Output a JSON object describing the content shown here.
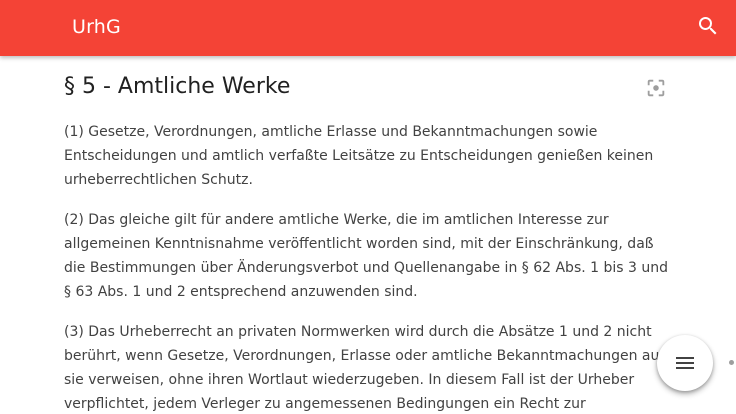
{
  "app_bar": {
    "title": "UrhG",
    "search_icon": "search-icon"
  },
  "section": {
    "title": "§ 5 - Amtliche Werke",
    "focus_icon": "center-focus-icon"
  },
  "paragraphs": [
    "(1) Gesetze, Verordnungen, amtliche Erlasse und Bekanntmachungen sowie\nEntscheidungen und amtlich verfaßte Leitsätze zu Entscheidungen genießen keinen\nurheberrechtlichen Schutz.",
    "(2) Das gleiche gilt für andere amtliche Werke, die im amtlichen Interesse zur\nallgemeinen Kenntnisnahme veröffentlicht worden sind, mit der Einschränkung, daß\ndie Bestimmungen über Änderungsverbot und Quellenangabe in § 62 Abs. 1 bis 3 und\n§ 63 Abs. 1 und 2 entsprechend anzuwenden sind.",
    "(3) Das Urheberrecht an privaten Normwerken wird durch die Absätze 1 und 2 nicht\nberührt, wenn Gesetze, Verordnungen, Erlasse oder amtliche Bekanntmachungen auf\nsie verweisen, ohne ihren Wortlaut wiederzugeben. In diesem Fall ist der Urheber\nverpflichtet, jedem Verleger zu angemessenen Bedingungen ein Recht zur"
  ],
  "fab": {
    "icon": "menu-icon"
  },
  "colors": {
    "app_bar": "#f44336",
    "title_text": "#212121",
    "body_text": "#424242",
    "icon_gray": "#9e9e9e"
  }
}
